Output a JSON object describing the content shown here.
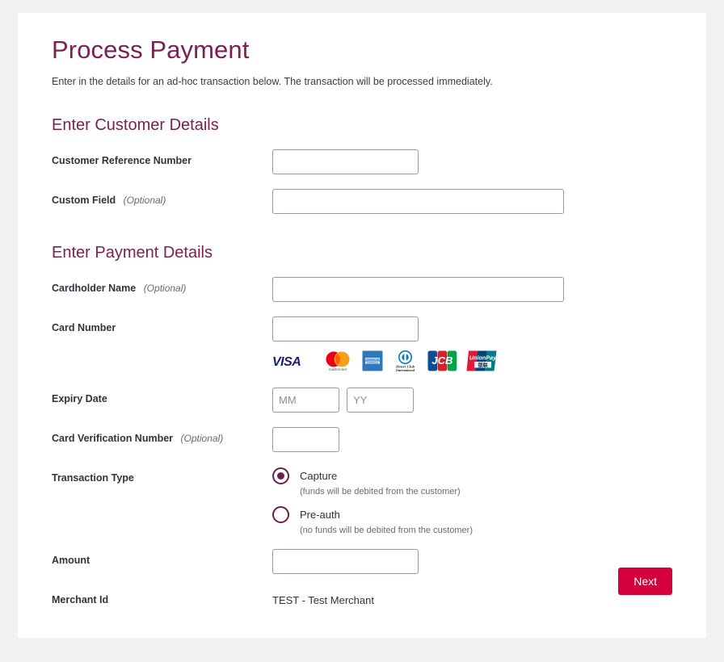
{
  "page": {
    "title": "Process Payment",
    "subtitle": "Enter in the details for an ad-hoc transaction below. The transaction will be processed immediately."
  },
  "sections": {
    "customer": {
      "heading": "Enter Customer Details"
    },
    "payment": {
      "heading": "Enter Payment Details"
    }
  },
  "fields": {
    "customer_reference_number": {
      "label": "Customer Reference Number",
      "optional": "",
      "value": "",
      "placeholder": ""
    },
    "custom_field": {
      "label": "Custom Field",
      "optional": "(Optional)",
      "value": "",
      "placeholder": ""
    },
    "cardholder_name": {
      "label": "Cardholder Name",
      "optional": "(Optional)",
      "value": "",
      "placeholder": ""
    },
    "card_number": {
      "label": "Card Number",
      "value": "",
      "placeholder": ""
    },
    "expiry_date": {
      "label": "Expiry Date",
      "month": {
        "value": "",
        "placeholder": "MM"
      },
      "year": {
        "value": "",
        "placeholder": "YY"
      }
    },
    "card_verification_number": {
      "label": "Card Verification Number",
      "optional": "(Optional)",
      "value": "",
      "placeholder": ""
    },
    "transaction_type": {
      "label": "Transaction Type"
    },
    "amount": {
      "label": "Amount",
      "value": "",
      "placeholder": ""
    },
    "merchant_id": {
      "label": "Merchant Id",
      "value": "TEST - Test Merchant"
    }
  },
  "transaction_types": [
    {
      "label": "Capture",
      "hint": "(funds will be debited from the customer)",
      "selected": true
    },
    {
      "label": "Pre-auth",
      "hint": "(no funds will be debited from the customer)",
      "selected": false
    }
  ],
  "card_brands": [
    {
      "name": "visa-logo",
      "label": "VISA"
    },
    {
      "name": "mastercard-logo",
      "label": "mastercard"
    },
    {
      "name": "amex-logo",
      "label": "AMERICAN EXPRESS"
    },
    {
      "name": "diners-club-logo",
      "label": "Diners Club International"
    },
    {
      "name": "jcb-logo",
      "label": "JCB"
    },
    {
      "name": "unionpay-logo",
      "label": "UnionPay"
    }
  ],
  "actions": {
    "next_label": "Next"
  },
  "colors": {
    "heading": "#7b2150",
    "accent_radio": "#6d1f4a",
    "next_button": "#d4003c",
    "page_background": "#f2f1ef",
    "card_background": "#ffffff"
  }
}
